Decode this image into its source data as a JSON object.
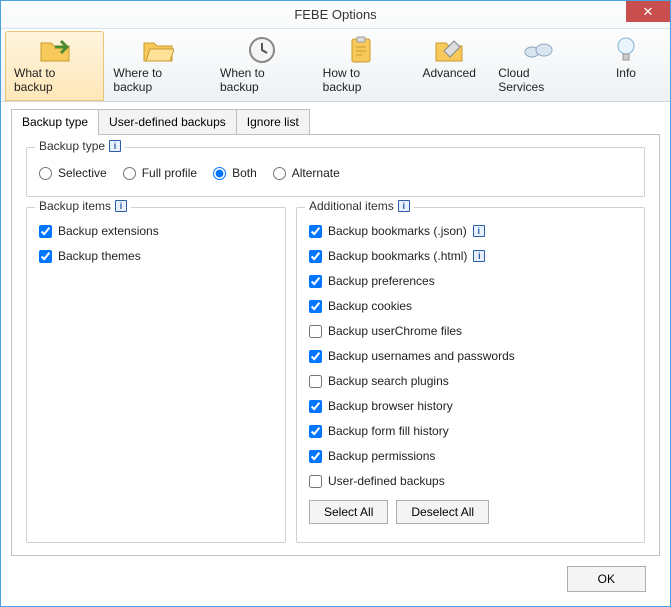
{
  "window": {
    "title": "FEBE Options",
    "close": "✕"
  },
  "toolbar": {
    "items": [
      {
        "label": "What to backup",
        "active": true
      },
      {
        "label": "Where to backup",
        "active": false
      },
      {
        "label": "When to backup",
        "active": false
      },
      {
        "label": "How to backup",
        "active": false
      },
      {
        "label": "Advanced",
        "active": false
      },
      {
        "label": "Cloud Services",
        "active": false
      },
      {
        "label": "Info",
        "active": false
      }
    ]
  },
  "tabs": {
    "items": [
      {
        "label": "Backup type",
        "active": true
      },
      {
        "label": "User-defined backups",
        "active": false
      },
      {
        "label": "Ignore list",
        "active": false
      }
    ]
  },
  "backup_type": {
    "legend": "Backup type",
    "options": [
      {
        "label": "Selective",
        "checked": false
      },
      {
        "label": "Full profile",
        "checked": false
      },
      {
        "label": "Both",
        "checked": true
      },
      {
        "label": "Alternate",
        "checked": false
      }
    ]
  },
  "backup_items": {
    "legend": "Backup items",
    "items": [
      {
        "label": "Backup extensions",
        "checked": true
      },
      {
        "label": "Backup themes",
        "checked": true
      }
    ]
  },
  "additional_items": {
    "legend": "Additional items",
    "items": [
      {
        "label": "Backup bookmarks (.json)",
        "checked": true,
        "info": true
      },
      {
        "label": "Backup bookmarks (.html)",
        "checked": true,
        "info": true
      },
      {
        "label": "Backup preferences",
        "checked": true
      },
      {
        "label": "Backup cookies",
        "checked": true
      },
      {
        "label": "Backup userChrome files",
        "checked": false
      },
      {
        "label": "Backup usernames and passwords",
        "checked": true
      },
      {
        "label": "Backup search plugins",
        "checked": false
      },
      {
        "label": "Backup browser history",
        "checked": true
      },
      {
        "label": "Backup form fill history",
        "checked": true
      },
      {
        "label": "Backup permissions",
        "checked": true
      },
      {
        "label": "User-defined backups",
        "checked": false
      }
    ],
    "select_all": "Select All",
    "deselect_all": "Deselect All"
  },
  "footer": {
    "ok": "OK"
  },
  "info_glyph": "i"
}
